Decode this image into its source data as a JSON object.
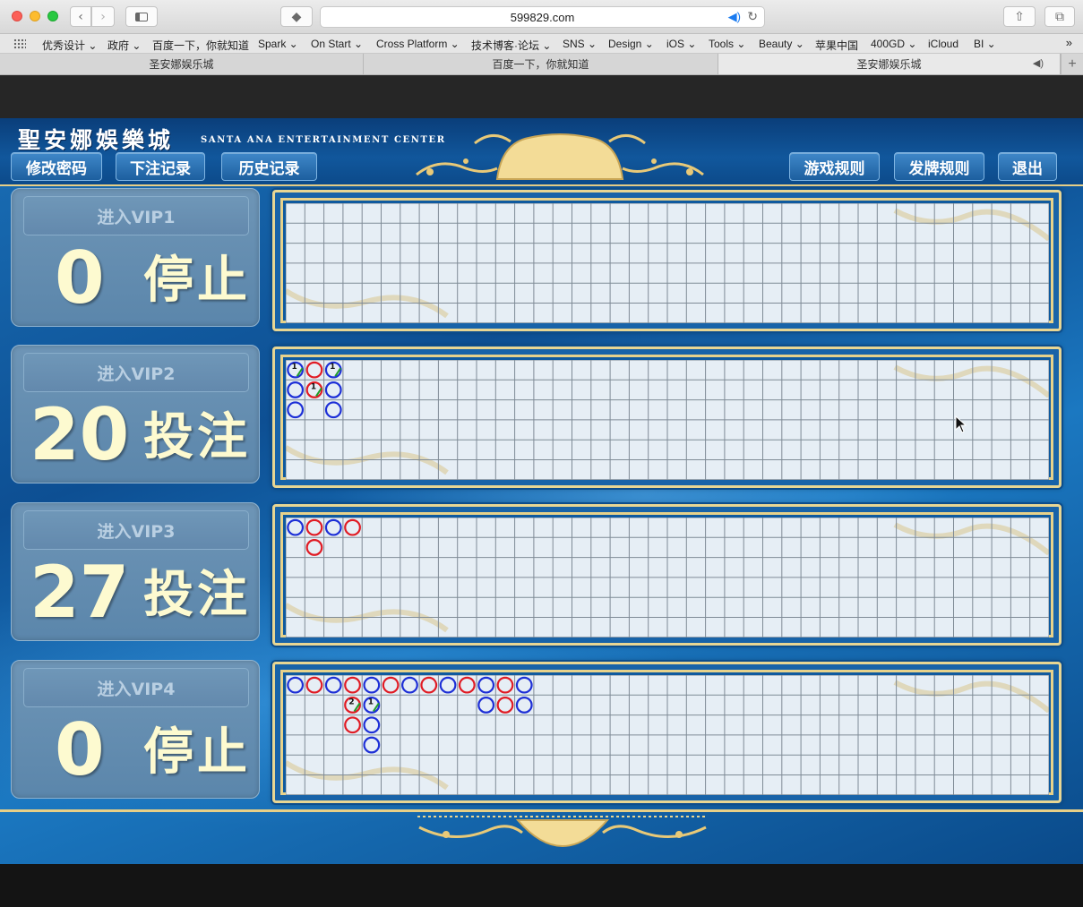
{
  "browser": {
    "url": "599829.com",
    "bookmarks": [
      "优秀设计",
      "政府",
      "百度一下，你就知道",
      "Spark",
      "On Start",
      "Cross Platform",
      "技术博客·论坛",
      "SNS",
      "Design",
      "iOS",
      "Tools",
      "Beauty",
      "苹果中国",
      "400GD",
      "iCloud",
      "BI"
    ],
    "bookmark_has_menu": [
      true,
      true,
      false,
      true,
      true,
      true,
      true,
      true,
      true,
      true,
      true,
      true,
      false,
      true,
      false,
      true
    ],
    "tabs": [
      {
        "label": "圣安娜娱乐城",
        "active": false
      },
      {
        "label": "百度一下，你就知道",
        "active": false
      },
      {
        "label": "圣安娜娱乐城",
        "active": true
      }
    ]
  },
  "site": {
    "logo_cn": "聖安娜娛樂城",
    "logo_en": "SANTA ANA ENTERTAINMENT CENTER",
    "nav_left": [
      "修改密码",
      "下注记录",
      "历史记录"
    ],
    "nav_right": [
      "游戏规则",
      "发牌规则",
      "退出"
    ]
  },
  "rooms": [
    {
      "title": "进入VIP1",
      "count": "0",
      "status": "停止",
      "beads": []
    },
    {
      "title": "进入VIP2",
      "count": "20",
      "status": "投注",
      "beads": [
        {
          "col": 0,
          "row": 0,
          "color": "blue",
          "label": "1"
        },
        {
          "col": 0,
          "row": 1,
          "color": "blue"
        },
        {
          "col": 0,
          "row": 2,
          "color": "blue"
        },
        {
          "col": 1,
          "row": 0,
          "color": "red"
        },
        {
          "col": 1,
          "row": 1,
          "color": "red",
          "label": "1"
        },
        {
          "col": 2,
          "row": 0,
          "color": "blue",
          "label": "1"
        },
        {
          "col": 2,
          "row": 1,
          "color": "blue"
        },
        {
          "col": 2,
          "row": 2,
          "color": "blue"
        }
      ]
    },
    {
      "title": "进入VIP3",
      "count": "27",
      "status": "投注",
      "beads": [
        {
          "col": 0,
          "row": 0,
          "color": "blue"
        },
        {
          "col": 1,
          "row": 0,
          "color": "red"
        },
        {
          "col": 1,
          "row": 1,
          "color": "red"
        },
        {
          "col": 2,
          "row": 0,
          "color": "blue"
        },
        {
          "col": 3,
          "row": 0,
          "color": "red"
        }
      ]
    },
    {
      "title": "进入VIP4",
      "count": "0",
      "status": "停止",
      "beads": [
        {
          "col": 0,
          "row": 0,
          "color": "blue"
        },
        {
          "col": 1,
          "row": 0,
          "color": "red"
        },
        {
          "col": 2,
          "row": 0,
          "color": "blue"
        },
        {
          "col": 3,
          "row": 0,
          "color": "red"
        },
        {
          "col": 3,
          "row": 1,
          "color": "red",
          "label": "2"
        },
        {
          "col": 3,
          "row": 2,
          "color": "red"
        },
        {
          "col": 4,
          "row": 0,
          "color": "blue"
        },
        {
          "col": 4,
          "row": 1,
          "color": "blue",
          "label": "1"
        },
        {
          "col": 4,
          "row": 2,
          "color": "blue"
        },
        {
          "col": 4,
          "row": 3,
          "color": "blue"
        },
        {
          "col": 5,
          "row": 0,
          "color": "red"
        },
        {
          "col": 6,
          "row": 0,
          "color": "blue"
        },
        {
          "col": 7,
          "row": 0,
          "color": "red"
        },
        {
          "col": 8,
          "row": 0,
          "color": "blue"
        },
        {
          "col": 9,
          "row": 0,
          "color": "red"
        },
        {
          "col": 10,
          "row": 0,
          "color": "blue"
        },
        {
          "col": 10,
          "row": 1,
          "color": "blue"
        },
        {
          "col": 11,
          "row": 0,
          "color": "red"
        },
        {
          "col": 11,
          "row": 1,
          "color": "red"
        },
        {
          "col": 12,
          "row": 0,
          "color": "blue"
        },
        {
          "col": 12,
          "row": 1,
          "color": "blue"
        }
      ]
    }
  ],
  "colors": {
    "bead_red": "#e01b24",
    "bead_blue": "#1d2fd6",
    "grid_line": "#7f8b96",
    "grid_bg": "#e6eef5",
    "gold": "#e8d693"
  }
}
